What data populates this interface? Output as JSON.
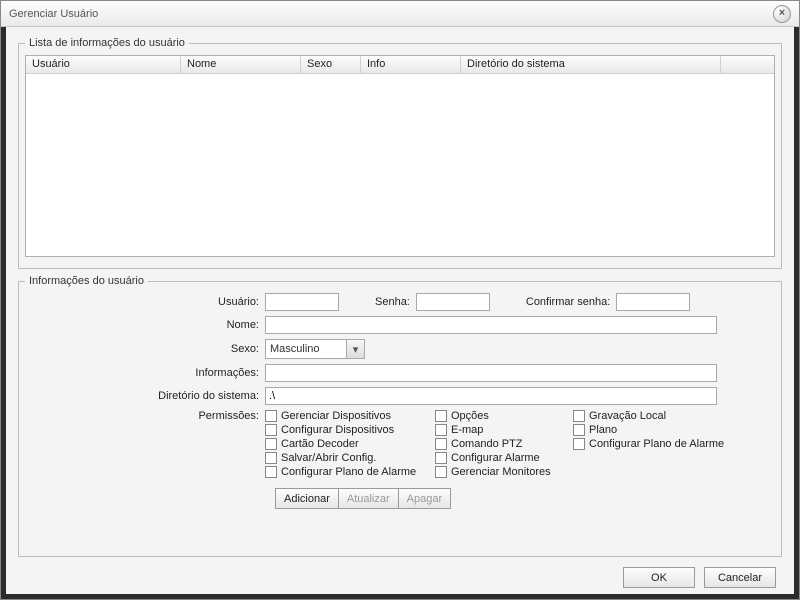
{
  "window": {
    "title": "Gerenciar Usuário"
  },
  "list": {
    "legend": "Lista de informações do usuário",
    "columns": [
      "Usuário",
      "Nome",
      "Sexo",
      "Info",
      "Diretório do sistema",
      ""
    ],
    "rows": []
  },
  "info": {
    "legend": "Informações do usuário",
    "labels": {
      "usuario": "Usuário:",
      "senha": "Senha:",
      "confirmar": "Confirmar senha:",
      "nome": "Nome:",
      "sexo": "Sexo:",
      "informacoes": "Informações:",
      "diretorio": "Diretório do sistema:",
      "permissoes": "Permissões:"
    },
    "values": {
      "usuario": "",
      "senha": "",
      "confirmar": "",
      "nome": "",
      "sexo": "Masculino",
      "informacoes": "",
      "diretorio": ".\\"
    },
    "permissions": {
      "col1": [
        "Gerenciar Dispositivos",
        "Configurar Dispositivos",
        "Cartão Decoder",
        "Salvar/Abrir Config.",
        "Configurar Plano de Alarme"
      ],
      "col2": [
        "Opções",
        "E-map",
        "Comando PTZ",
        "Configurar Alarme",
        "Gerenciar Monitores"
      ],
      "col3": [
        "Gravação Local",
        "Plano",
        "Configurar Plano de Alarme"
      ]
    },
    "buttons": {
      "adicionar": "Adicionar",
      "atualizar": "Atualizar",
      "apagar": "Apagar"
    }
  },
  "footer": {
    "ok": "OK",
    "cancelar": "Cancelar"
  }
}
